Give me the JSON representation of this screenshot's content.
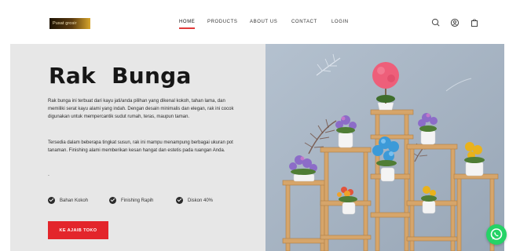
{
  "header": {
    "logo_text": "Pusat grosir",
    "nav": [
      {
        "label": "HOME",
        "active": true
      },
      {
        "label": "PRODUCTS",
        "active": false
      },
      {
        "label": "ABOUT US",
        "active": false
      },
      {
        "label": "CONTACT",
        "active": false
      },
      {
        "label": "LOGIN",
        "active": false
      }
    ],
    "icons": [
      "search-icon",
      "user-icon",
      "cart-icon"
    ]
  },
  "hero": {
    "title": "Rak  Bunga",
    "paragraph_1": "Rak bunga ini terbuat dari kayu jati/anda pilihan yang dikenal kokoh, tahan lama, dan memiliki serat kayu alami yang indah. Dengan desain minimalis dan elegan, rak ini cocok digunakan untuk mempercantik sudut rumah, teras, maupun taman.",
    "paragraph_2": "Tersedia dalam beberapa tingkat susun, rak ini mampu menampung berbagai ukuran pot tanaman. Finishing alami memberikan kesan hangat dan estetis pada ruangan Anda.",
    "separator": ".",
    "features": [
      {
        "label": "Bahan Kokoh",
        "icon": "check-circle-icon"
      },
      {
        "label": "Finishing Rapih",
        "icon": "check-circle-icon"
      },
      {
        "label": "Diskon 40%",
        "icon": "check-circle-icon"
      }
    ],
    "cta_label": "KE AJAIB TOKO"
  },
  "image": {
    "subject": "wooden-plant-shelf-with-artificial-flowers",
    "wall_color": "#a9b7c7",
    "wood_color": "#d6a56a"
  },
  "floating": {
    "whatsapp_icon": "whatsapp-icon",
    "color": "#25d366"
  },
  "colors": {
    "accent": "#e3252b",
    "hero_bg": "#e7e7e7",
    "text": "#161616"
  }
}
